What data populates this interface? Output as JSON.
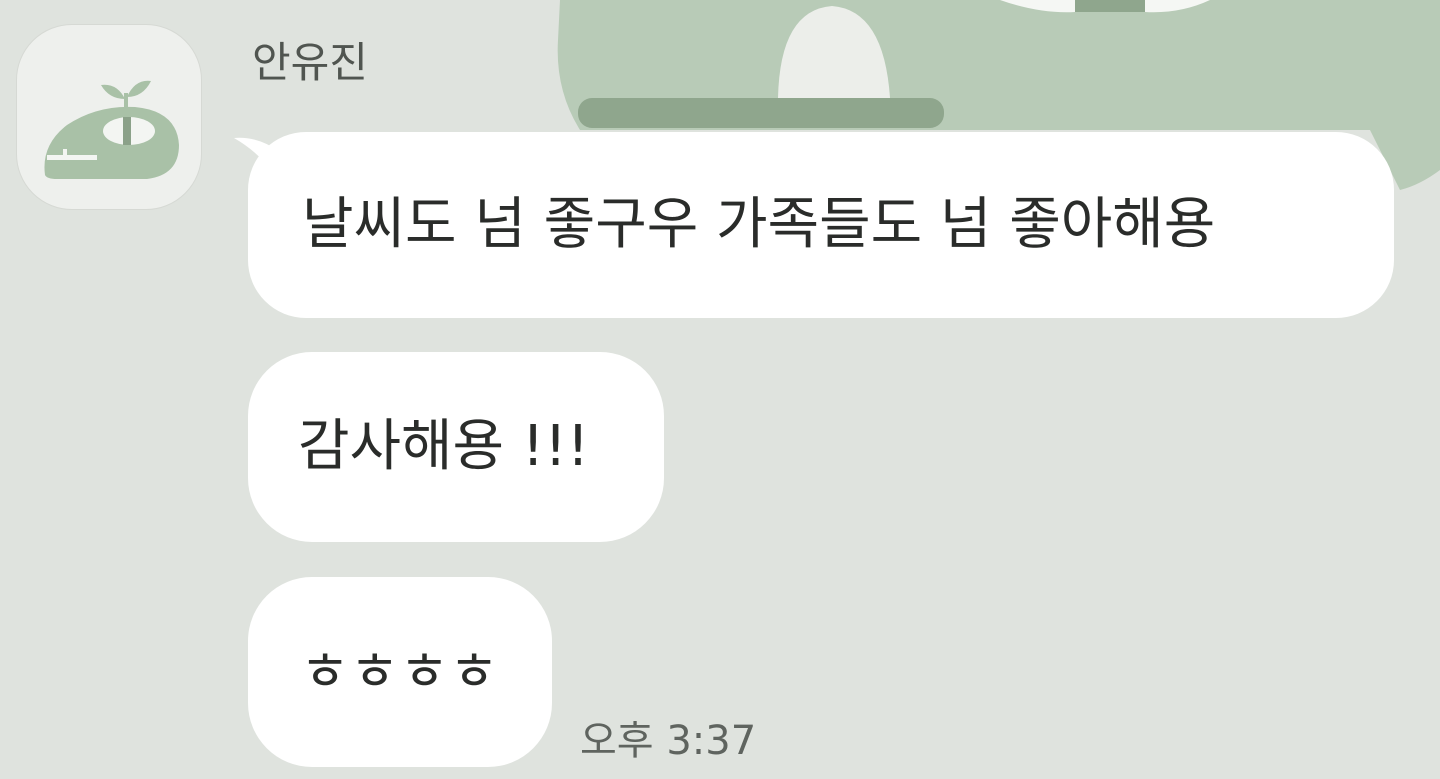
{
  "chat": {
    "sender": {
      "name": "안유진",
      "avatar_icon": "plant-sprout-creature-icon"
    },
    "messages": [
      {
        "text": "날씨도 넘 좋구우 가족들도 넘 좋아해용"
      },
      {
        "text": "감사해용 !!!"
      },
      {
        "text": "ㅎㅎㅎㅎ"
      }
    ],
    "timestamp": "오후 3:37"
  },
  "colors": {
    "background": "#dfe3de",
    "wallpaper_shape": "#b8cbb7",
    "bubble": "#ffffff",
    "avatar_figure": "#a9c1a7"
  }
}
